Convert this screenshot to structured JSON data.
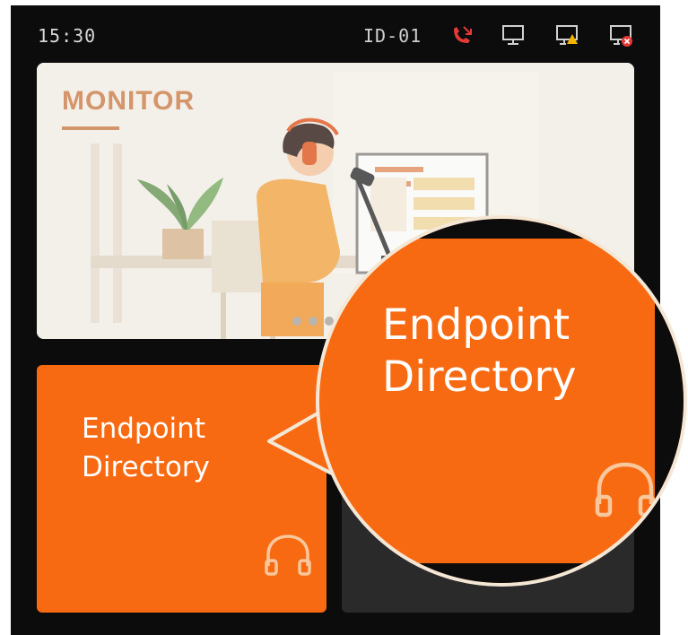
{
  "status_bar": {
    "time": "15:30",
    "device_id": "ID-01",
    "icons": [
      "missed-call-icon",
      "monitor-connected-icon",
      "monitor-warning-icon",
      "monitor-error-icon"
    ]
  },
  "banner": {
    "title": "MONITOR",
    "carousel_pages": 3,
    "carousel_active": 1
  },
  "tiles": [
    {
      "label": "Endpoint Directory",
      "icon": "headphones-icon",
      "color": "#f76a12"
    }
  ],
  "callout": {
    "label": "Endpoint Directory",
    "icon": "headphones-icon"
  },
  "colors": {
    "accent": "#f76a12",
    "background": "#0c0c0c",
    "alert_red": "#e53935",
    "warning_yellow": "#f3b400",
    "monitor_title": "#d4956a"
  }
}
